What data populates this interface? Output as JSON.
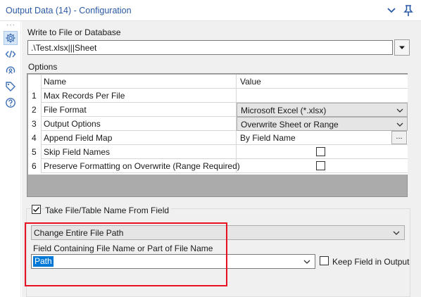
{
  "window": {
    "title": "Output Data (14) - Configuration",
    "icons": [
      "chevron-down-icon",
      "pin-icon"
    ]
  },
  "toolrail": {
    "icons": [
      "gear-icon",
      "code-icon",
      "annotation-icon",
      "tag-icon",
      "help-icon"
    ]
  },
  "write_section": {
    "label": "Write to File or Database",
    "path_value": ".\\Test.xlsx|||Sheet"
  },
  "options": {
    "label": "Options",
    "columns": [
      "Name",
      "Value"
    ],
    "rows": [
      {
        "num": "1",
        "name": "Max Records Per File",
        "value": "",
        "kind": "text"
      },
      {
        "num": "2",
        "name": "File Format",
        "value": "Microsoft Excel (*.xlsx)",
        "kind": "combo"
      },
      {
        "num": "3",
        "name": "Output Options",
        "value": "Overwrite Sheet or Range",
        "kind": "combo"
      },
      {
        "num": "4",
        "name": "Append Field Map",
        "value": "By Field Name",
        "kind": "button",
        "button_label": "..."
      },
      {
        "num": "5",
        "name": "Skip Field Names",
        "value": "",
        "kind": "checkbox",
        "checked": false
      },
      {
        "num": "6",
        "name": "Preserve Formatting on Overwrite (Range Required)",
        "value": "",
        "kind": "checkbox",
        "checked": false
      }
    ]
  },
  "take_file": {
    "label": "Take File/Table Name From Field",
    "checked": true,
    "mode_value": "Change Entire File Path",
    "field_label": "Field Containing File Name or Part of File Name",
    "field_value": "Path",
    "keep_label": "Keep Field in Output",
    "keep_checked": false
  },
  "colors": {
    "title": "#2b5aa5",
    "highlight": "#e81123",
    "selection": "#0078d7"
  }
}
